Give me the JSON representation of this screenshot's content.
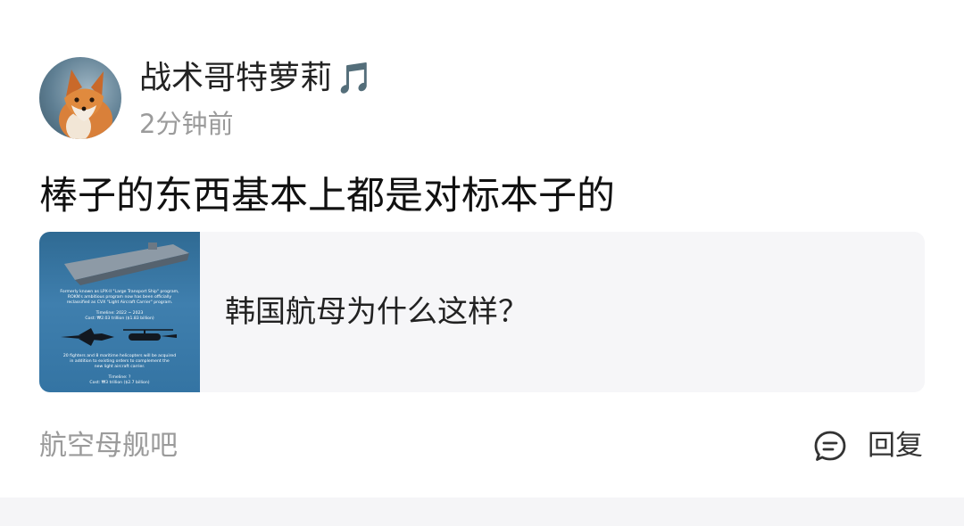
{
  "post": {
    "username": "战术哥特萝莉",
    "username_emoji": "🎵",
    "time": "2分钟前",
    "text": "棒子的东西基本上都是对标本子的",
    "card": {
      "title": "韩国航母为什么这样？",
      "thumb_lines": [
        "Formerly known as LPX-II \"Large Transport Ship\" program,",
        "ROKN's ambitious program now has been officially",
        "reclassified as CVX \"Light Aircraft Carrier\" program.",
        "Timeline: 2022 ~ 2023",
        "Cost: ₩2.03 trillion ($1.83 billion)",
        "20 fighters and 8 maritime helicopters will be acquired",
        "in addition to existing orders to complement the",
        "new light aircraft carrier.",
        "Timeline: ?",
        "Cost: ₩3 trillion ($2.7 billion)"
      ]
    },
    "forum": "航空母舰吧",
    "reply_label": "回复"
  },
  "colors": {
    "primary_text": "#111111",
    "secondary_text": "#9b9b9b",
    "card_bg": "#f6f6f8",
    "thumb_bg": "#3474a3"
  },
  "icons": {
    "avatar": "fox-avatar",
    "reply": "chat-bubble-icon"
  }
}
